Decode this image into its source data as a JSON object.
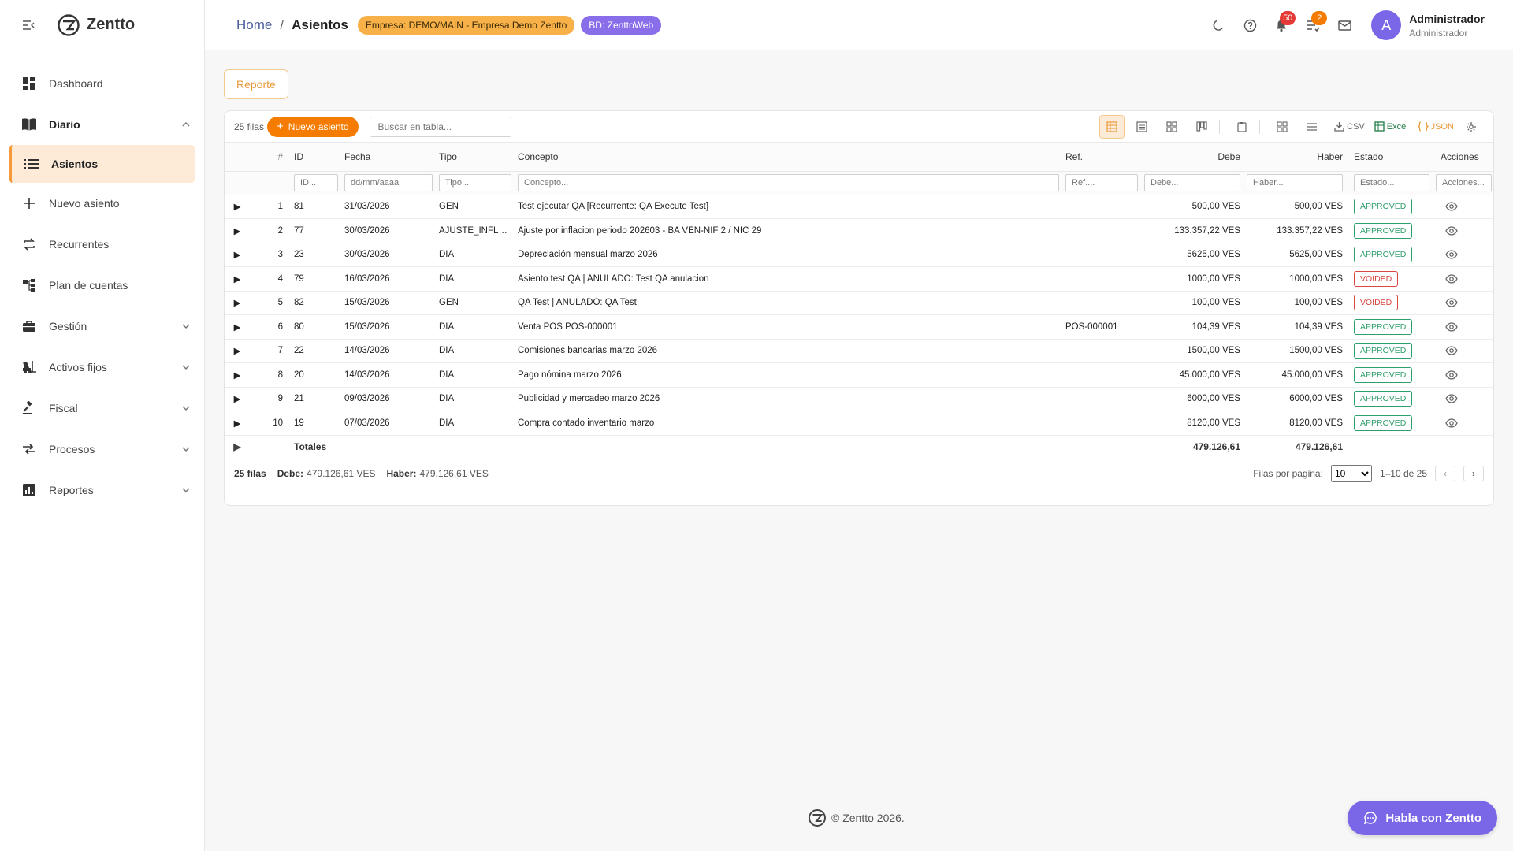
{
  "brand": {
    "name": "Zentto"
  },
  "sidebar": {
    "items": [
      {
        "label": "Dashboard"
      },
      {
        "label": "Diario"
      },
      {
        "label": "Asientos"
      },
      {
        "label": "Nuevo asiento"
      },
      {
        "label": "Recurrentes"
      },
      {
        "label": "Plan de cuentas"
      },
      {
        "label": "Gestión"
      },
      {
        "label": "Activos fijos"
      },
      {
        "label": "Fiscal"
      },
      {
        "label": "Procesos"
      },
      {
        "label": "Reportes"
      }
    ]
  },
  "header": {
    "home": "Home",
    "separator": "/",
    "current": "Asientos",
    "empresa_chip": "Empresa: DEMO/MAIN - Empresa Demo Zentto",
    "bd_chip": "BD: ZenttoWeb",
    "notifications_count": "50",
    "tasks_count": "2",
    "avatar_initial": "A",
    "user_name": "Administrador",
    "user_role": "Administrador"
  },
  "main": {
    "report_button": "Reporte"
  },
  "toolbar": {
    "rows_label": "25 filas",
    "new_button": "Nuevo asiento",
    "search_placeholder": "Buscar en tabla...",
    "csv": "CSV",
    "excel": "Excel",
    "json": "JSON"
  },
  "table": {
    "columns": {
      "num": "#",
      "id": "ID",
      "fecha": "Fecha",
      "tipo": "Tipo",
      "concepto": "Concepto",
      "ref": "Ref.",
      "debe": "Debe",
      "haber": "Haber",
      "estado": "Estado",
      "acciones": "Acciones"
    },
    "filters": {
      "id": "ID...",
      "fecha": "dd/mm/aaaa",
      "tipo": "Tipo...",
      "concepto": "Concepto...",
      "ref": "Ref....",
      "debe": "Debe...",
      "haber": "Haber...",
      "estado": "Estado...",
      "acciones": "Acciones..."
    },
    "rows": [
      {
        "n": "1",
        "id": "81",
        "fecha": "31/03/2026",
        "tipo": "GEN",
        "concepto": "Test ejecutar QA [Recurrente: QA Execute Test]",
        "ref": "",
        "debe": "500,00 VES",
        "haber": "500,00 VES",
        "estado": "APPROVED"
      },
      {
        "n": "2",
        "id": "77",
        "fecha": "30/03/2026",
        "tipo": "AJUSTE_INFLACION",
        "concepto": "Ajuste por inflacion periodo 202603 - BA VEN-NIF 2 / NIC 29",
        "ref": "",
        "debe": "133.357,22 VES",
        "haber": "133.357,22 VES",
        "estado": "APPROVED"
      },
      {
        "n": "3",
        "id": "23",
        "fecha": "30/03/2026",
        "tipo": "DIA",
        "concepto": "Depreciación mensual marzo 2026",
        "ref": "",
        "debe": "5625,00 VES",
        "haber": "5625,00 VES",
        "estado": "APPROVED"
      },
      {
        "n": "4",
        "id": "79",
        "fecha": "16/03/2026",
        "tipo": "DIA",
        "concepto": "Asiento test QA | ANULADO: Test QA anulacion",
        "ref": "",
        "debe": "1000,00 VES",
        "haber": "1000,00 VES",
        "estado": "VOIDED"
      },
      {
        "n": "5",
        "id": "82",
        "fecha": "15/03/2026",
        "tipo": "GEN",
        "concepto": "QA Test | ANULADO: QA Test",
        "ref": "",
        "debe": "100,00 VES",
        "haber": "100,00 VES",
        "estado": "VOIDED"
      },
      {
        "n": "6",
        "id": "80",
        "fecha": "15/03/2026",
        "tipo": "DIA",
        "concepto": "Venta POS POS-000001",
        "ref": "POS-000001",
        "debe": "104,39 VES",
        "haber": "104,39 VES",
        "estado": "APPROVED"
      },
      {
        "n": "7",
        "id": "22",
        "fecha": "14/03/2026",
        "tipo": "DIA",
        "concepto": "Comisiones bancarias marzo 2026",
        "ref": "",
        "debe": "1500,00 VES",
        "haber": "1500,00 VES",
        "estado": "APPROVED"
      },
      {
        "n": "8",
        "id": "20",
        "fecha": "14/03/2026",
        "tipo": "DIA",
        "concepto": "Pago nómina marzo 2026",
        "ref": "",
        "debe": "45.000,00 VES",
        "haber": "45.000,00 VES",
        "estado": "APPROVED"
      },
      {
        "n": "9",
        "id": "21",
        "fecha": "09/03/2026",
        "tipo": "DIA",
        "concepto": "Publicidad y mercadeo marzo 2026",
        "ref": "",
        "debe": "6000,00 VES",
        "haber": "6000,00 VES",
        "estado": "APPROVED"
      },
      {
        "n": "10",
        "id": "19",
        "fecha": "07/03/2026",
        "tipo": "DIA",
        "concepto": "Compra contado inventario marzo",
        "ref": "",
        "debe": "8120,00 VES",
        "haber": "8120,00 VES",
        "estado": "APPROVED"
      }
    ],
    "totals": {
      "label": "Totales",
      "debe": "479.126,61",
      "haber": "479.126,61"
    }
  },
  "footer_bar": {
    "rows_label": "25 filas",
    "debe_label": "Debe:",
    "debe_value": "479.126,61 VES",
    "haber_label": "Haber:",
    "haber_value": "479.126,61 VES",
    "per_page_label": "Filas por pagina:",
    "per_page_value": "10",
    "range": "1–10 de 25",
    "prev": "‹",
    "next": "›"
  },
  "copyright": "© Zentto 2026.",
  "chat_button": "Habla con Zentto",
  "colors": {
    "accent": "#f57c00",
    "purple": "#7a67e8",
    "approved": "#2e9e6a",
    "voided": "#d9473f"
  }
}
